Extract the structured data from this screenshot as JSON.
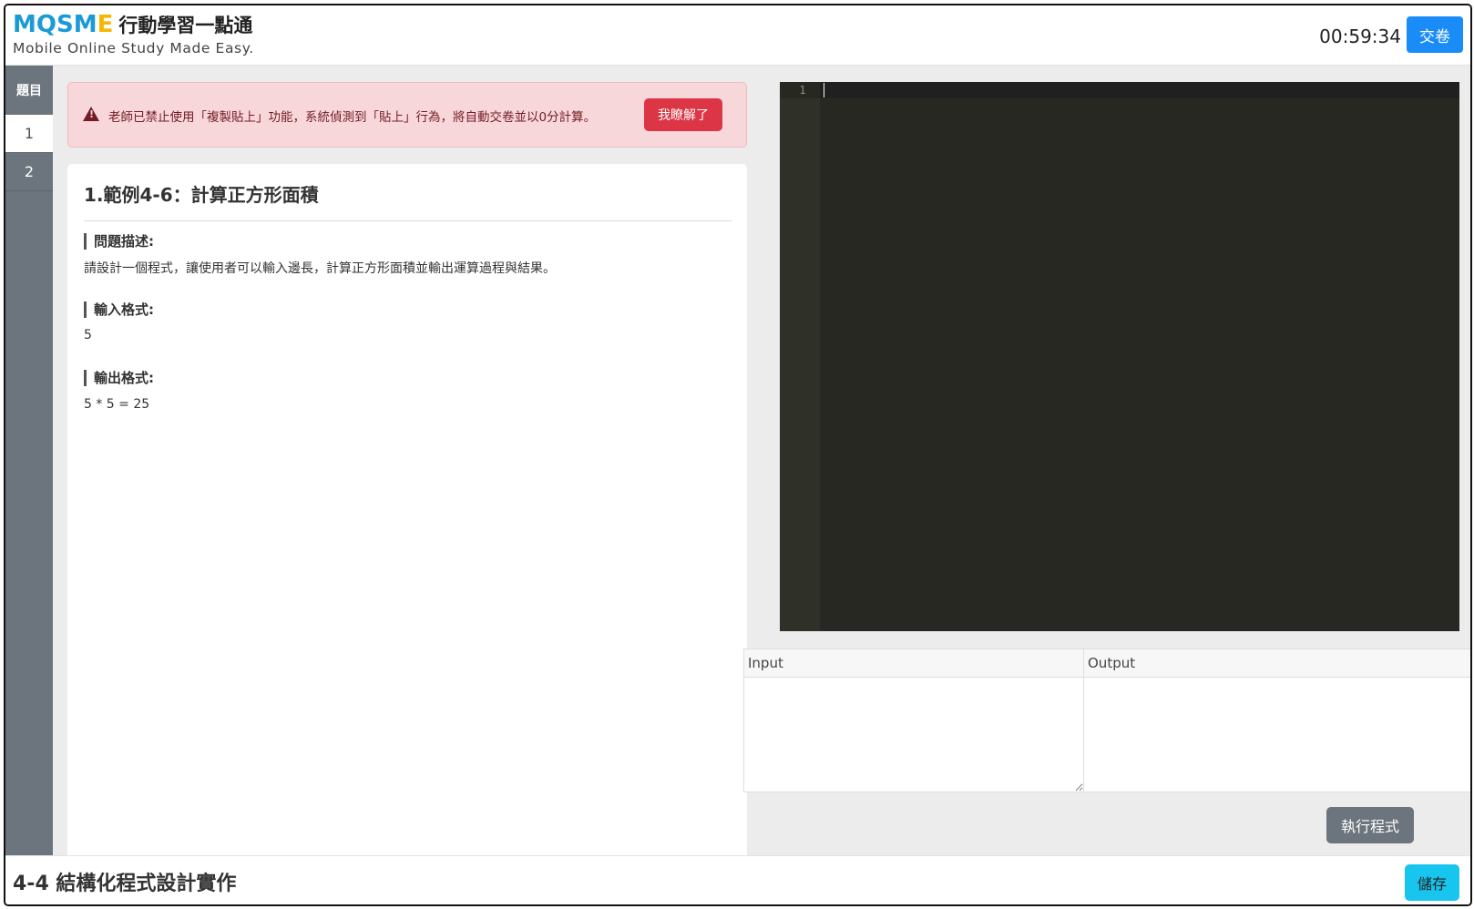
{
  "header": {
    "logo": {
      "brand_part1": "M",
      "brand_part2": "Q",
      "brand_part3": "SM",
      "brand_part4": "E",
      "chinese_name": "行動學習一點通",
      "tagline": "Mobile Online Study Made Easy."
    },
    "timer": "00:59:34",
    "submit_label": "交卷"
  },
  "sidebar": {
    "heading": "題目",
    "items": [
      {
        "label": "1",
        "active": true
      },
      {
        "label": "2",
        "active": false
      }
    ]
  },
  "alert": {
    "message": "老師已禁止使用「複製貼上」功能，系統偵測到「貼上」行為，將自動交卷並以0分計算。",
    "button_label": "我瞭解了"
  },
  "question": {
    "title": "1.範例4-6：計算正方形面積",
    "description_label": "問題描述:",
    "description": "請設計一個程式，讓使用者可以輸入邊長，計算正方形面積並輸出運算過程與結果。",
    "input_label": "輸入格式:",
    "input_example": "5",
    "output_label": "輸出格式:",
    "output_example": "5 * 5 = 25"
  },
  "editor": {
    "line_numbers": [
      "1"
    ],
    "content": ""
  },
  "io": {
    "input_label": "Input",
    "output_label": "Output",
    "input_value": "",
    "output_value": ""
  },
  "run_label": "執行程式",
  "footer": {
    "title": "4-4 結構化程式設計實作",
    "save_label": "儲存"
  },
  "colors": {
    "brand_blue": "#1a9ad6",
    "brand_yellow": "#f5b800",
    "submit_blue": "#1a8cf8",
    "alert_bg": "#f8d7da",
    "alert_button": "#dc3545",
    "sidebar_gray": "#6c757d",
    "editor_bg": "#272822",
    "save_cyan": "#17c5ef"
  }
}
